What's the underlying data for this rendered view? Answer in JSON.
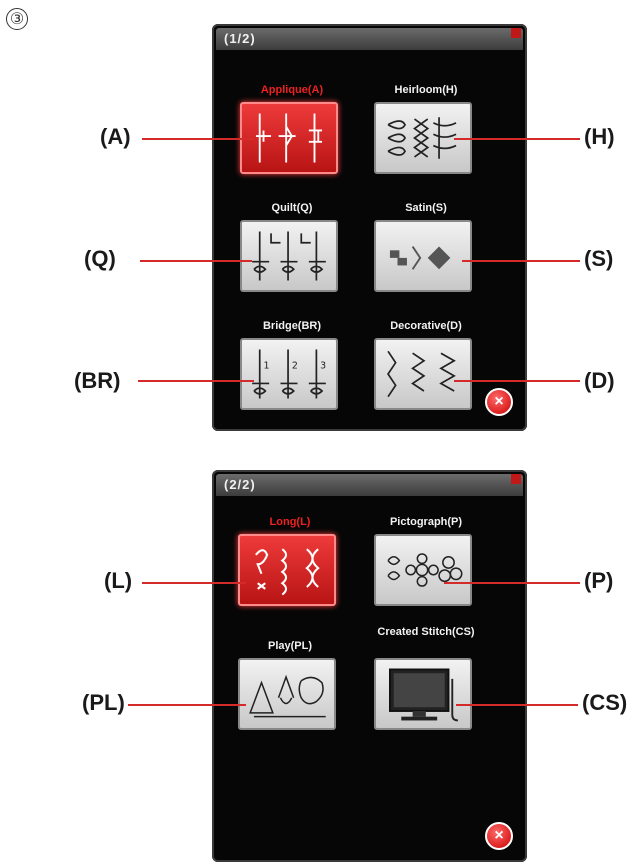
{
  "step_marker": "③",
  "screen1": {
    "page_indicator": "(1/2)",
    "categories": [
      {
        "label": "Applique(A)",
        "callout": "(A)",
        "active": true,
        "icon": "applique-stitch-icon"
      },
      {
        "label": "Heirloom(H)",
        "callout": "(H)",
        "active": false,
        "icon": "heirloom-stitch-icon"
      },
      {
        "label": "Quilt(Q)",
        "callout": "(Q)",
        "active": false,
        "icon": "quilt-stitch-icon"
      },
      {
        "label": "Satin(S)",
        "callout": "(S)",
        "active": false,
        "icon": "satin-stitch-icon"
      },
      {
        "label": "Bridge(BR)",
        "callout": "(BR)",
        "active": false,
        "icon": "bridge-stitch-icon"
      },
      {
        "label": "Decorative(D)",
        "callout": "(D)",
        "active": false,
        "icon": "decorative-stitch-icon"
      }
    ],
    "close_symbol": "×"
  },
  "screen2": {
    "page_indicator": "(2/2)",
    "categories": [
      {
        "label": "Long(L)",
        "callout": "(L)",
        "active": true,
        "icon": "long-stitch-icon"
      },
      {
        "label": "Pictograph(P)",
        "callout": "(P)",
        "active": false,
        "icon": "pictograph-stitch-icon"
      },
      {
        "label": "Play(PL)",
        "callout": "(PL)",
        "active": false,
        "icon": "play-stitch-icon"
      },
      {
        "label": "Created Stitch(CS)",
        "callout": "(CS)",
        "active": false,
        "icon": "computer-icon"
      }
    ],
    "close_symbol": "×"
  },
  "colors": {
    "leader": "#d42a2a",
    "active": "#ee2020",
    "screen": "#060606"
  }
}
